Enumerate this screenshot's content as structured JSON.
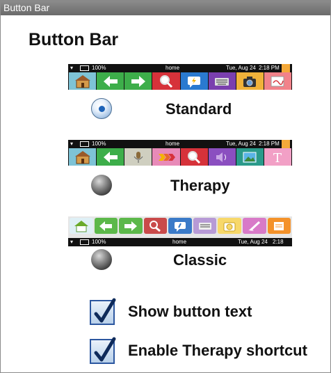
{
  "window": {
    "title": "Button Bar"
  },
  "heading": "Button Bar",
  "status_bar": {
    "battery": "100%",
    "app": "home",
    "date": "Tue, Aug 24",
    "time": "2:18 PM"
  },
  "options": [
    {
      "label": "Standard",
      "selected": true
    },
    {
      "label": "Therapy",
      "selected": false
    },
    {
      "label": "Classic",
      "selected": false
    }
  ],
  "checkboxes": [
    {
      "label": "Show button text",
      "checked": true
    },
    {
      "label": "Enable Therapy shortcut",
      "checked": true
    }
  ],
  "bars": {
    "standard": [
      "home-icon",
      "back-arrow-icon",
      "forward-arrow-icon",
      "search-icon",
      "quick-talk-icon",
      "keyboard-icon",
      "camera-icon",
      "edit-icon"
    ],
    "therapy": [
      "home-icon",
      "back-arrow-icon",
      "microphone-icon",
      "arrows-icon",
      "search-icon",
      "speaker-icon",
      "image-icon",
      "text-icon"
    ],
    "classic": [
      "home-icon",
      "back-arrow-icon",
      "forward-arrow-icon",
      "search-icon",
      "quick-talk-icon",
      "keyboard-icon",
      "camera-icon",
      "pen-icon",
      "notes-icon"
    ]
  },
  "colors": {
    "titlebar": "#7a7a7a",
    "radio_selected": "#1d63b8",
    "checkbox_border": "#2c57a0"
  }
}
